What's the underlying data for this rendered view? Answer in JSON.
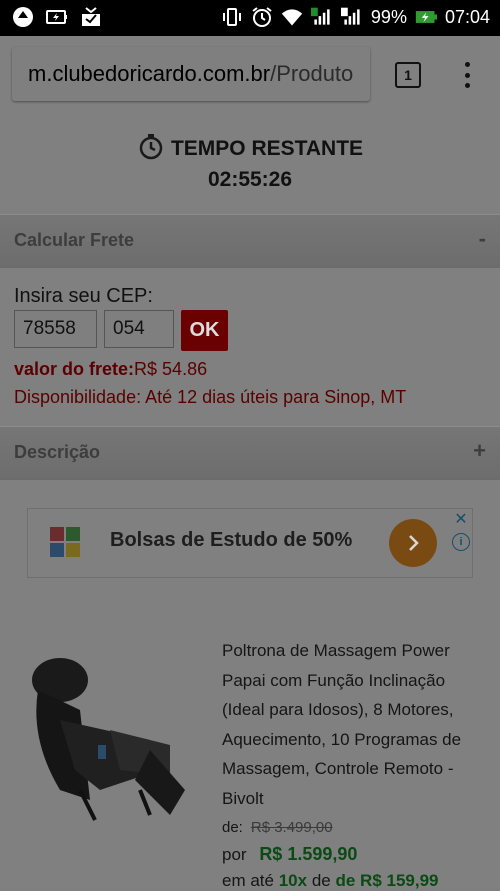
{
  "status_bar": {
    "battery_percent": "99%",
    "time": "07:04",
    "signal_labels": [
      "1",
      "2"
    ]
  },
  "browser": {
    "url_domain": "m.clubedoricardo.com.br",
    "url_path": "/Produto",
    "tab_count": "1"
  },
  "timer": {
    "label": "TEMPO RESTANTE",
    "time": "02:55:26"
  },
  "frete_section": {
    "title": "Calcular Frete",
    "toggle": "-",
    "cep_label": "Insira seu CEP:",
    "cep_part1": "78558",
    "cep_part2": "054",
    "ok_label": "OK",
    "frete_label": "valor do frete:",
    "frete_value": "R$ 54.86",
    "disponibilidade": "Disponibilidade: Até 12 dias úteis para Sinop, MT"
  },
  "descricao_section": {
    "title": "Descrição",
    "toggle": "+"
  },
  "ad": {
    "text": "Bolsas de Estudo de 50%",
    "close": "✕",
    "info": "i"
  },
  "product": {
    "title": "Poltrona de Massagem Power Papai com Função Inclinação (Ideal para Idosos), 8 Motores, Aquecimento, 10 Programas de Massagem, Controle Remoto - Bivolt",
    "de_label": "de:",
    "old_price": "R$ 3.499,00",
    "por_label": "por",
    "price": "R$  1.599,90",
    "installment_prefix": "em até",
    "installments": "10x",
    "installment_mid": "de",
    "installment_value": "de R$ 159,99"
  },
  "colors": {
    "overlay_gray": "#808080",
    "ok_red": "#6b0000",
    "price_green": "#0b4a14",
    "ad_orange": "#7a4a13"
  }
}
